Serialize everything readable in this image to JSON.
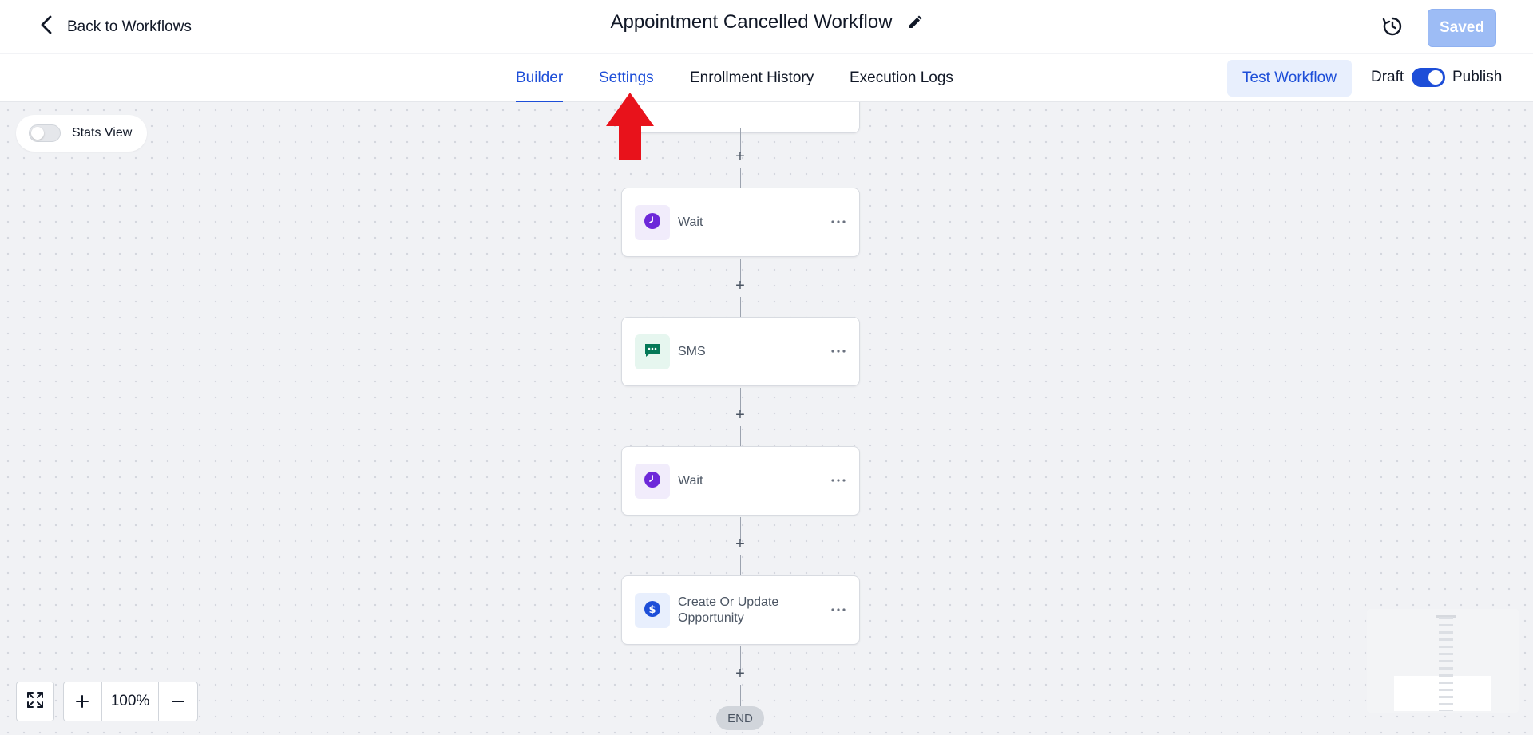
{
  "header": {
    "back_label": "Back to Workflows",
    "title": "Appointment Cancelled Workflow",
    "saved_label": "Saved"
  },
  "tabs": [
    {
      "label": "Builder",
      "active": true
    },
    {
      "label": "Settings",
      "active": false
    },
    {
      "label": "Enrollment History",
      "active": false
    },
    {
      "label": "Execution Logs",
      "active": false
    }
  ],
  "actions": {
    "test_label": "Test Workflow",
    "draft_label": "Draft",
    "publish_label": "Publish",
    "published": true
  },
  "canvas": {
    "stats_label": "Stats View",
    "stats_enabled": false,
    "nodes": [
      {
        "label": "Wait",
        "icon": "clock-icon",
        "color": "#6d28d9"
      },
      {
        "label": "SMS",
        "icon": "chat-icon",
        "color": "#047857"
      },
      {
        "label": "Wait",
        "icon": "clock-icon",
        "color": "#6d28d9"
      },
      {
        "label": "Create Or Update Opportunity",
        "icon": "dollar-icon",
        "color": "#1d4ed8"
      }
    ],
    "add_symbol": "+",
    "end_label": "END",
    "zoom_level": "100%"
  },
  "colors": {
    "accent": "#1d4ed8",
    "arrow": "#e8121b"
  }
}
